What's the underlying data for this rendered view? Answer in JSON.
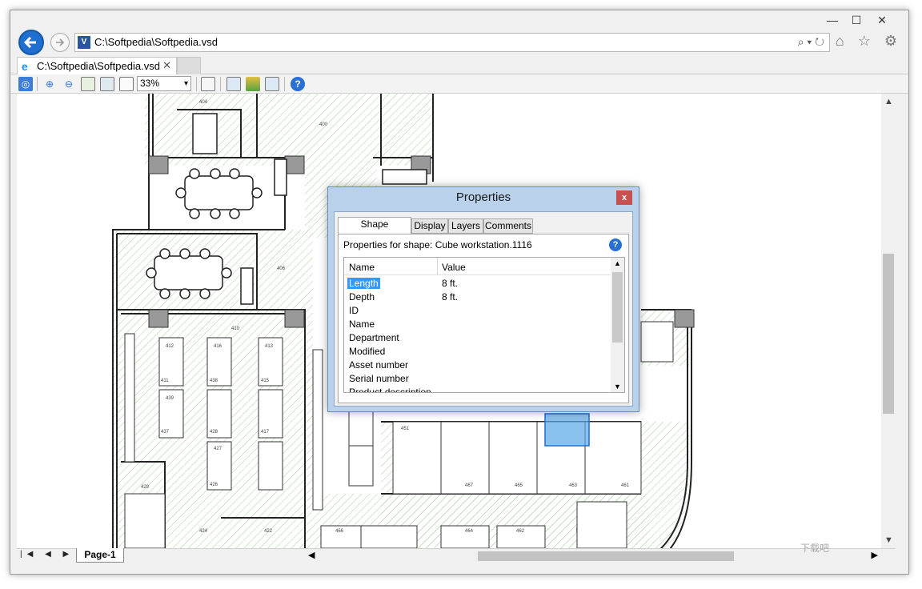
{
  "window": {
    "minimize": "—",
    "maximize": "☐",
    "close": "✕"
  },
  "address_bar": {
    "url": "C:\\Softpedia\\Softpedia.vsd",
    "search_icons": "⌕ ▾ ↻"
  },
  "nav_icons": "⌂ ☆ ⚙",
  "tab": {
    "label": "C:\\Softpedia\\Softpedia.vsd",
    "close": "✕"
  },
  "toolbar": {
    "zoom_value": "33%"
  },
  "page_tabs": {
    "nav": "|◀ ◀ ▶ ▶|",
    "current": "Page-1"
  },
  "dialog": {
    "title": "Properties",
    "close": "x",
    "tabs": [
      "Shape Properties",
      "Display",
      "Layers",
      "Comments"
    ],
    "active_tab": "Shape Properties",
    "properties_for": "Properties for shape: Cube workstation.1116",
    "help": "?",
    "columns": [
      "Name",
      "Value"
    ],
    "rows": [
      {
        "name": "Length",
        "value": "8 ft.",
        "selected": true
      },
      {
        "name": "Depth",
        "value": "8 ft."
      },
      {
        "name": "ID",
        "value": ""
      },
      {
        "name": "Name",
        "value": ""
      },
      {
        "name": "Department",
        "value": ""
      },
      {
        "name": "Modified",
        "value": ""
      },
      {
        "name": "Asset number",
        "value": ""
      },
      {
        "name": "Serial number",
        "value": ""
      },
      {
        "name": "Product description",
        "value": ""
      }
    ]
  },
  "floorplan_labels": {
    "r404": "404",
    "r400": "400",
    "r406": "406",
    "r410": "410",
    "r412": "412",
    "r416": "416",
    "r413": "413",
    "r411": "411",
    "r438": "438",
    "r439": "439",
    "r415": "415",
    "r437": "437",
    "r428": "428",
    "r427": "427",
    "r417": "417",
    "r426": "426",
    "r429": "429",
    "r424": "424",
    "r422": "422",
    "r451": "451",
    "r467": "467",
    "r465": "465",
    "r463": "463",
    "r461": "461",
    "r466": "466",
    "r462": "462",
    "r464": "464"
  },
  "watermark": "下载吧"
}
